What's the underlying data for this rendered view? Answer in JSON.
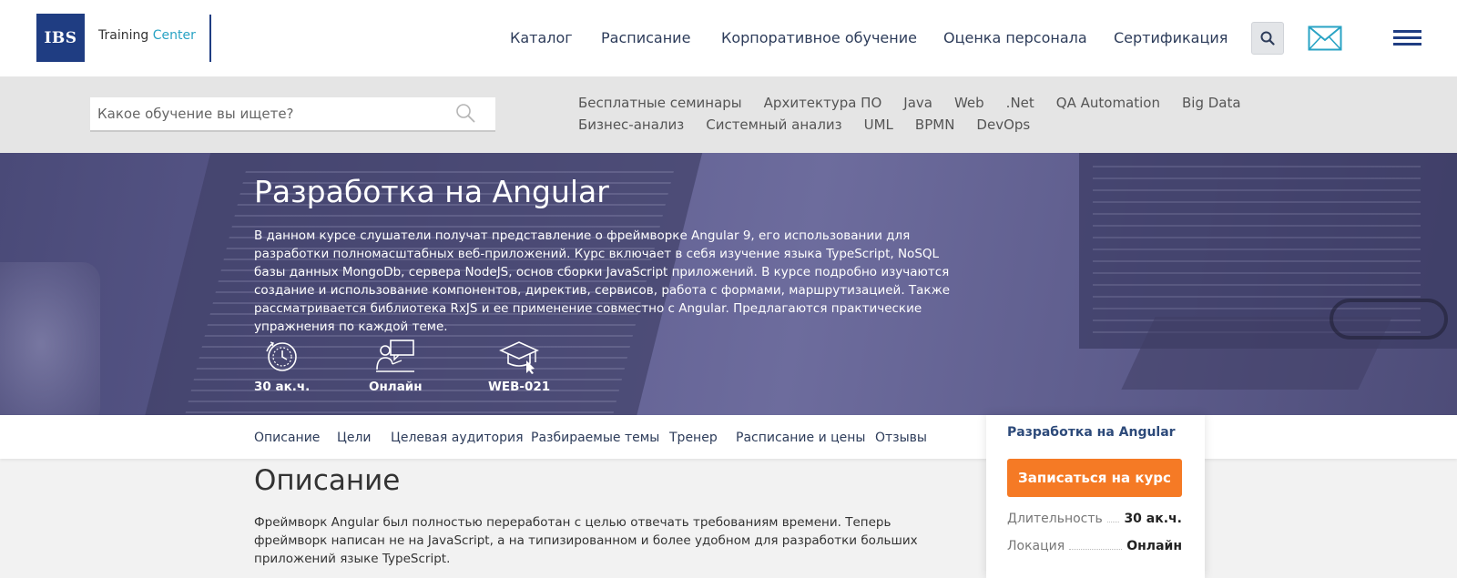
{
  "header": {
    "logo_mark": "IBS",
    "logo_text_main": "Training",
    "logo_text_accent": "Center",
    "nav": [
      {
        "label": "Каталог"
      },
      {
        "label": "Расписание"
      },
      {
        "label": "Корпоративное обучение"
      },
      {
        "label": "Оценка персонала"
      },
      {
        "label": "Сертификация"
      }
    ],
    "icons": {
      "search": "search-icon",
      "mail": "mail-icon",
      "menu": "hamburger-icon"
    }
  },
  "search": {
    "placeholder": "Какое обучение вы ищете?",
    "value": "",
    "tags": [
      "Бесплатные семинары",
      "Архитектура ПО",
      "Java",
      "Web",
      ".Net",
      "QA Automation",
      "Big Data",
      "Бизнес-анализ",
      "Системный анализ",
      "UML",
      "BPMN",
      "DevOps"
    ]
  },
  "hero": {
    "title": "Разработка на Angular",
    "description": "В данном курсе слушатели получат представление о фреймворке Angular 9, его использовании для разработки полномасштабных веб-приложений. Курс включает в себя изучение языка TypeScript, NoSQL базы данных MongoDb, сервера NodeJS, основ сборки JavaScript приложений. В курсе подробно изучаются создание и использование компонентов, директив, сервисов, работа с формами, маршрутизацией. Также рассматривается библиотека RxJS и ее применение совместно с Angular. Предлагаются практические упражнения по каждой теме.",
    "features": [
      {
        "icon": "clock-icon",
        "label": "30 ак.ч."
      },
      {
        "icon": "online-presenter-icon",
        "label": "Онлайн"
      },
      {
        "icon": "graduation-cap-icon",
        "label": "WEB-021"
      }
    ]
  },
  "subnav": [
    "Описание",
    "Цели",
    "Целевая аудитория",
    "Разбираемые темы",
    "Тренер",
    "Расписание и цены",
    "Отзывы"
  ],
  "content": {
    "section_title": "Описание",
    "section_text": "Фреймворк Angular был полностью переработан с целью отвечать требованиям времени. Теперь фреймворк написан не на JavaScript, а на типизированном и более удобном для разработки больших приложений языке TypeScript."
  },
  "card": {
    "title": "Разработка на Angular",
    "button": "Записаться на курс",
    "rows": [
      {
        "key": "Длительность",
        "value": "30 ак.ч."
      },
      {
        "key": "Локация",
        "value": "Онлайн"
      }
    ]
  },
  "colors": {
    "brand_navy": "#1f3d82",
    "accent_teal": "#29a3c4",
    "cta_orange": "#f57a25",
    "hero_overlay": "#5d5c8f"
  }
}
